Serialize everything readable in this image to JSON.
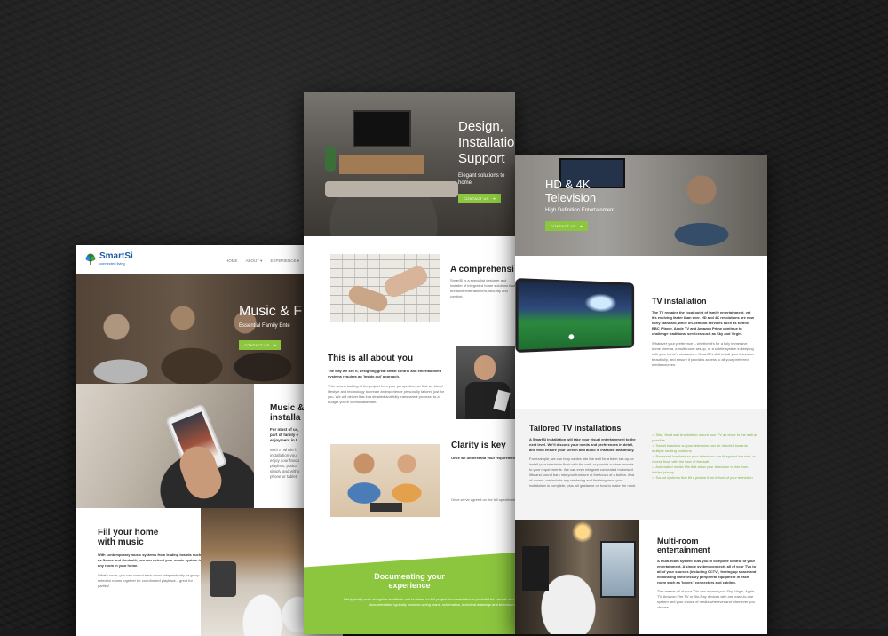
{
  "colors": {
    "accent": "#8cc63f",
    "background": "#1c1c1c",
    "text": "#222222"
  },
  "left": {
    "logo": {
      "name": "SmartSi",
      "tagline": "connected living",
      "icon": "tree-icon"
    },
    "nav": [
      "HOME",
      "ABOUT",
      "EXPERIENCE"
    ],
    "hero": {
      "title": "Music & F",
      "subtitle": "Essential Family Ente",
      "button": "CONTACT US"
    },
    "section1": {
      "title_line1": "Music &",
      "title_line2": "installa",
      "p1": "For most of us,",
      "p2": "part of family e",
      "p3": "enjoyment in t",
      "p4": "With a ‘whole h",
      "p5": "installation you",
      "p6": "enjoy your favou",
      "p7": "playlists, podca",
      "p8": "simply and witho",
      "p9": "phone or tablet"
    },
    "section2": {
      "title_line1": "Fill your home",
      "title_line2": "with music",
      "body": "With contemporary music systems from leading brands such as Sonos and Control4, you can extend your music system to any room in your home.",
      "body2": "What's more, you can control each room independently, or group selected rooms together for coordinated playback – great for parties!"
    }
  },
  "middle": {
    "hero": {
      "title": "Design, Installation & Support",
      "subtitle": "Elegant solutions to",
      "subtitle2": "home",
      "button": "CONTACT US"
    },
    "sec1": {
      "title": "A comprehensi",
      "text": "SmartSi is a specialist designer and installer of integrated home solutions that enhance entertainment, security and comfort."
    },
    "sec2": {
      "title": "This is all about you",
      "lead": "The way we see it, designing great smart control and entertainment systems requires an 'inside-out' approach.",
      "body": "This means looking at the project from your perspective, so that we blend lifestyle and technology to create an experience personally tailored just for you. We will deliver this in a detailed and fully transparent process, to a budget you're comfortable with."
    },
    "sec3": {
      "title": "Clarity is key",
      "lead": "Once we understand your requirements we'll provide a budget guide and options that include Essential, Enhanced and Premium designs, along with itemised pricing for each. So you have the information you need when making choices for your home entertainment systems.",
      "body": "Once we've agreed on the full specification we'll complete installation, we will provide a clear schedule. This helps you monitor every aspect of the work, for full satisfaction and sign-off. We will also talk to you about everything we're doing along the way."
    },
    "band": {
      "title_line1": "Documenting your",
      "title_line2": "experience",
      "text": "We typically work alongside architects and builders, so full project documentation is provided for smooth and efficient installations, Such documentation typically includes wiring plans, schematics, technical drawings and technical submittals."
    }
  },
  "right": {
    "hero": {
      "title_line1": "HD & 4K",
      "title_line2": "Television",
      "subtitle": "High Definition Entertainment",
      "button": "CONTACT US"
    },
    "tv": {
      "title": "TV installation",
      "lead": "The TV remains the focal point of family entertainment, yet it's evolving faster than ever. HD and 4K resolutions are now fairly standard, while on-demand services such as Netflix, BBC iPlayer, Apple TV and Amazon Prime continue to challenge traditional services such as Sky and Virgin.",
      "body": "Whatever your preference – whether it's for a fully immersive home cinema, a multi-room set-up, or a subtle system in keeping with your home's character – SmartSi's skill install your television beautifully, and ensure it provides access to all your preferred media sources."
    },
    "tailored": {
      "title": "Tailored TV installations",
      "lead": "A SmartSi installation will take your visual entertainment to the next level. We'll discuss your needs and preferences in detail, and then ensure your screen and audio is installed beautifully.",
      "body": "For example, we can bury cables into the wall for a tidier set-up, or install your television flush with the wall, or provide custom mounts to your requirements. We can even integrate concealed motorised lifts and sound bars into your furniture at the touch of a button. And of course, we include any rendering and finishing once your installation is complete, plus full guidance on how to make the most of your new SmartSi TV system straight away.",
      "bullets": [
        "Slim, fixed wall brackets to mount your TV as close to the wall as possible",
        "Swivel brackets so your television can be directed towards multiple seating positions",
        "Recessed brackets so your television can fit against the wall, or recess flush with the face of the wall",
        "Automated media lifts that allow your television to rise from hidden joinery",
        "Sound systems that lift a picture from infront of your television"
      ]
    },
    "multi": {
      "title_line1": "Multi-room",
      "title_line2": "entertainment",
      "lead": "A multi-room system puts you in complete control of your entertainment. A single system connects all of your TVs to all of your sources (including CCTV), freeing up space and eliminating unnecessary peripheral equipment in each room such as 'boxes', connectors and cabling.",
      "body": "This means all of your TVs can access your Sky, Virgin, Apple TV, Amazon Fire TV or Blu-Ray devices with one easy-to-use system and your choice of media wherever and whenever you choose."
    }
  }
}
